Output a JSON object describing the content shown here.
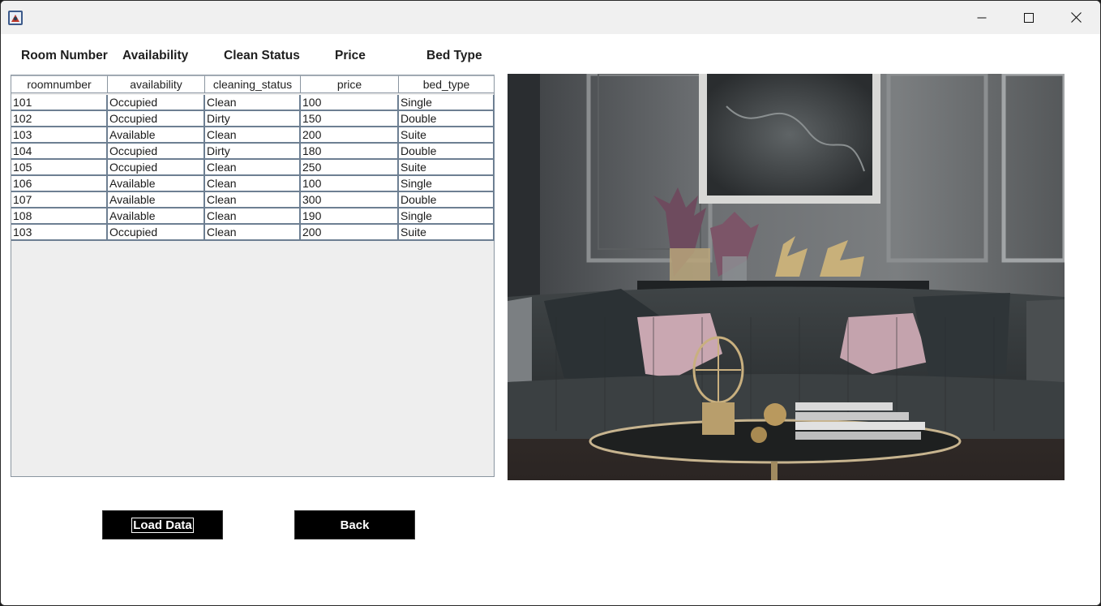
{
  "window": {
    "controls": {
      "minimize_icon": "minimize-icon",
      "maximize_icon": "maximize-icon",
      "close_icon": "close-icon"
    }
  },
  "labels": {
    "room_number": "Room Number",
    "availability": "Availability",
    "clean_status": "Clean Status",
    "price": "Price",
    "bed_type": "Bed Type"
  },
  "table": {
    "columns": [
      "roomnumber",
      "availability",
      "cleaning_status",
      "price",
      "bed_type"
    ],
    "rows": [
      [
        "101",
        "Occupied",
        "Clean",
        "100",
        "Single"
      ],
      [
        "102",
        "Occupied",
        "Dirty",
        "150",
        "Double"
      ],
      [
        "103",
        "Available",
        "Clean",
        "200",
        "Suite"
      ],
      [
        "104",
        "Occupied",
        "Dirty",
        "180",
        "Double"
      ],
      [
        "105",
        "Occupied",
        "Clean",
        "250",
        "Suite"
      ],
      [
        "106",
        "Available",
        "Clean",
        "100",
        "Single"
      ],
      [
        "107",
        "Available",
        "Clean",
        "300",
        "Double"
      ],
      [
        "108",
        "Available",
        "Clean",
        "190",
        "Single"
      ],
      [
        "103",
        "Occupied",
        "Clean",
        "200",
        "Suite"
      ]
    ]
  },
  "buttons": {
    "load_data": "Load Data",
    "back": "Back"
  },
  "colors": {
    "button_bg": "#000000",
    "button_text": "#ffffff",
    "grid_line": "#6d7f92"
  }
}
